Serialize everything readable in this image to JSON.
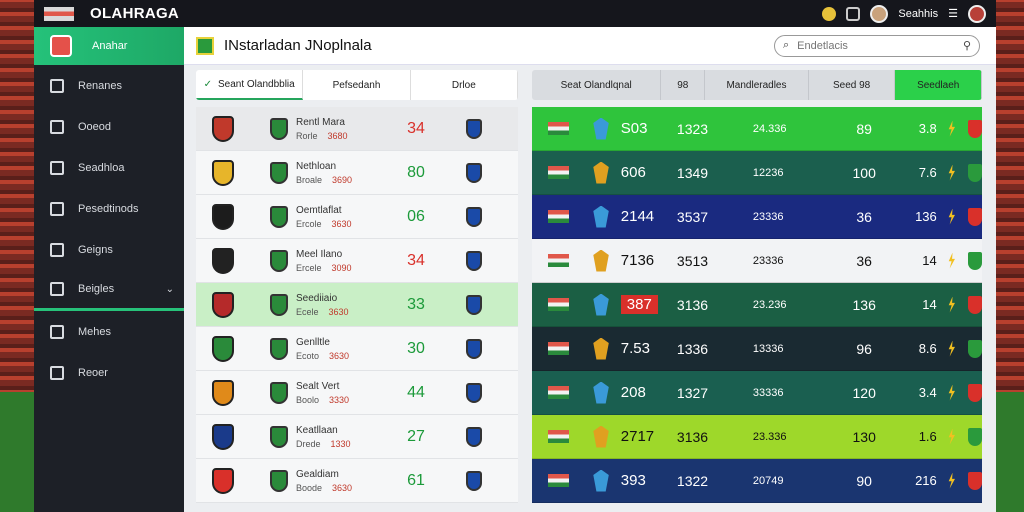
{
  "app": {
    "brand": "OLAHRAGA",
    "user": "Seahhis"
  },
  "sidebar": {
    "header": "Anahar",
    "items": [
      {
        "label": "Renanes"
      },
      {
        "label": "Ooeod"
      },
      {
        "label": "Seadhloa"
      },
      {
        "label": "Pesedtinods"
      },
      {
        "label": "Geigns"
      },
      {
        "label": "Beigles"
      },
      {
        "label": "Mehes"
      },
      {
        "label": "Reoer"
      }
    ]
  },
  "header": {
    "title": "INstarladan JNoplnala",
    "search_placeholder": "Endetlacis"
  },
  "tabs_left": [
    {
      "label": "Seant Olandbblia"
    },
    {
      "label": "Pefsedanh"
    },
    {
      "label": "Drloe"
    }
  ],
  "tabs_right": [
    {
      "label": "Seat Olandlqnal"
    },
    {
      "label": "98"
    },
    {
      "label": "Mandleradles"
    },
    {
      "label": "Seed 98"
    },
    {
      "label": "Seedlaeh"
    }
  ],
  "left_rows": [
    {
      "name": "Rentl Mara",
      "sub1": "Rorle",
      "sub2": "3680",
      "score": "34",
      "score_color": "red"
    },
    {
      "name": "Nethloan",
      "sub1": "Broale",
      "sub2": "3690",
      "score": "80",
      "score_color": "green"
    },
    {
      "name": "Oemtlaflat",
      "sub1": "Ercole",
      "sub2": "3630",
      "score": "06",
      "score_color": "green"
    },
    {
      "name": "Meel Ilano",
      "sub1": "Ercele",
      "sub2": "3090",
      "score": "34",
      "score_color": "red"
    },
    {
      "name": "Seediiaio",
      "sub1": "Ecele",
      "sub2": "3630",
      "score": "33",
      "score_color": "green"
    },
    {
      "name": "Genlltle",
      "sub1": "Ecoto",
      "sub2": "3630",
      "score": "30",
      "score_color": "green"
    },
    {
      "name": "Sealt Vert",
      "sub1": "Boolo",
      "sub2": "3330",
      "score": "44",
      "score_color": "green"
    },
    {
      "name": "Keatllaan",
      "sub1": "Drede",
      "sub2": "1330",
      "score": "27",
      "score_color": "green"
    },
    {
      "name": "Gealdiam",
      "sub1": "Boode",
      "sub2": "3630",
      "score": "61",
      "score_color": "green"
    }
  ],
  "right_rows": [
    {
      "v1": "S03",
      "v2": "1323",
      "v3": "24.336",
      "v4": "89",
      "v5": "3.8",
      "bg": "#2fc43c"
    },
    {
      "v1": "606",
      "v2": "1349",
      "v3": "12236",
      "v4": "100",
      "v5": "7.6",
      "bg": "#1b5f4e"
    },
    {
      "v1": "2144",
      "v2": "3537",
      "v3": "23336",
      "v4": "36",
      "v5": "136",
      "bg": "#1a2a80"
    },
    {
      "v1": "7136",
      "v2": "3513",
      "v3": "23336",
      "v4": "36",
      "v5": "14",
      "bg": "#f2f3f5"
    },
    {
      "v1": "387",
      "v2": "3136",
      "v3": "23.236",
      "v4": "136",
      "v5": "14",
      "bg": "#1b5f44"
    },
    {
      "v1": "7.53",
      "v2": "1336",
      "v3": "13336",
      "v4": "96",
      "v5": "8.6",
      "bg": "#1a2a32"
    },
    {
      "v1": "208",
      "v2": "1327",
      "v3": "33336",
      "v4": "120",
      "v5": "3.4",
      "bg": "#1a5f50"
    },
    {
      "v1": "2717",
      "v2": "3136",
      "v3": "23.336",
      "v4": "130",
      "v5": "1.6",
      "bg": "#9ed82a"
    },
    {
      "v1": "393",
      "v2": "1322",
      "v3": "20749",
      "v4": "90",
      "v5": "216",
      "bg": "#1a3570"
    }
  ]
}
